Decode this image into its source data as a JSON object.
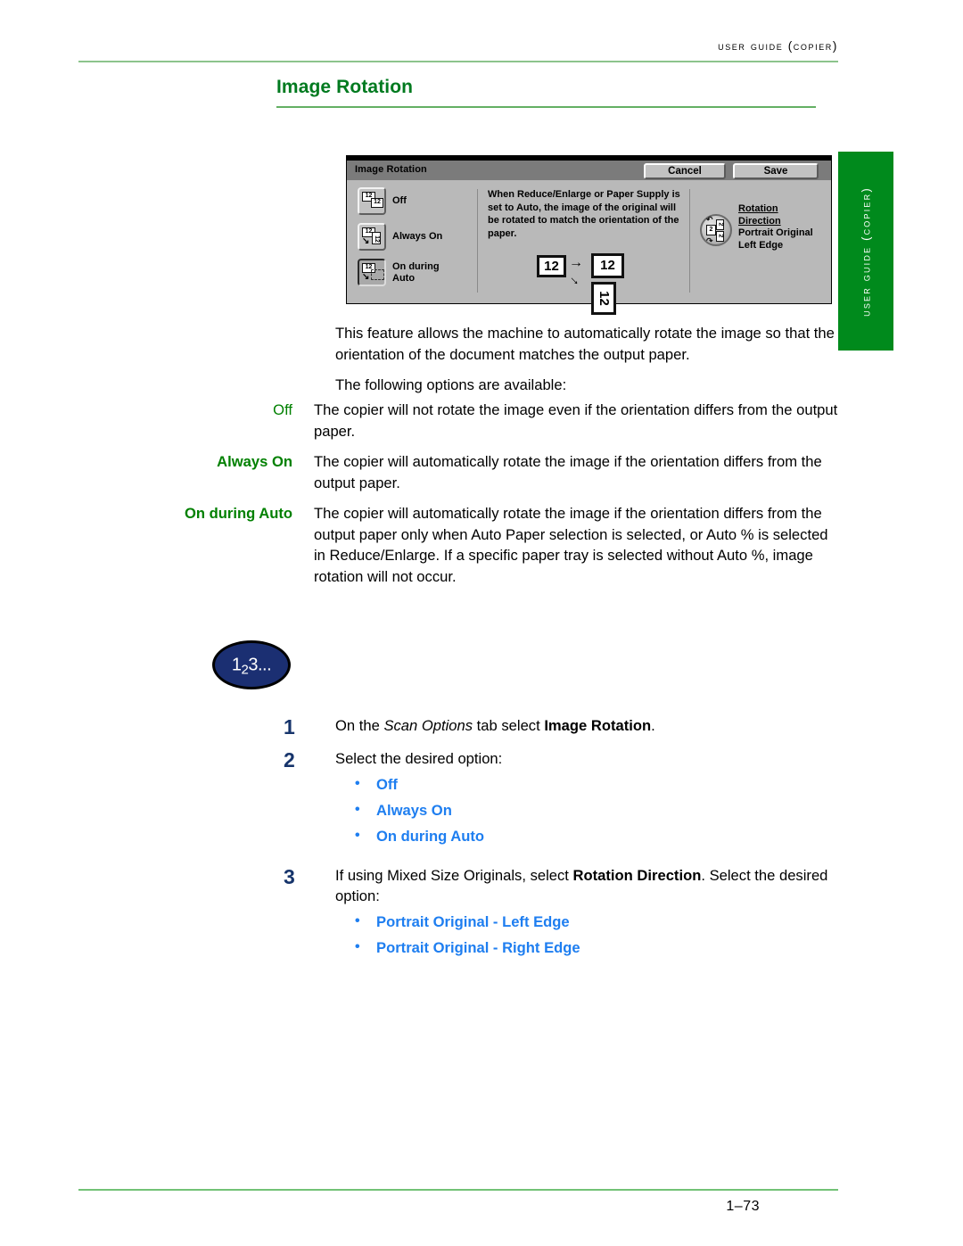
{
  "header": {
    "running_head": "User Guide (Copier)",
    "rule_color": "#8cc48c"
  },
  "title": {
    "text": "Image Rotation",
    "color": "#007a1f"
  },
  "side_tab": {
    "text": "User Guide (Copier)",
    "background": "#008a1c",
    "text_color": "#ffffff"
  },
  "ui_screenshot": {
    "titlebar": {
      "label": "Image Rotation",
      "cancel_label": "Cancel",
      "save_label": "Save"
    },
    "options": [
      {
        "label": "Off",
        "selected": false
      },
      {
        "label": "Always On",
        "selected": false
      },
      {
        "label": "On during\nAuto",
        "selected": true
      }
    ],
    "description": "When Reduce/Enlarge or Paper Supply is set to Auto, the image of the original will be rotated to match the orientation of the paper.",
    "diagram": {
      "source": "12",
      "dest_upright": "12",
      "dest_rotated": "12"
    },
    "rotation_direction": {
      "line1": "Rotation",
      "line2": "Direction",
      "line3": "Portrait Original",
      "line4": "Left Edge",
      "icon_digit": "2"
    }
  },
  "prose": {
    "para1": "This feature allows the machine to automatically rotate the image so that the orientation of the document matches the output paper.",
    "para2": "The following options are available:"
  },
  "definitions": [
    {
      "term": "Off",
      "description": "The copier will not rotate the image even if the orientation differs from the output paper."
    },
    {
      "term": "Always On",
      "description": "The copier will automatically rotate the image if the orientation differs from the output paper."
    },
    {
      "term": "On during Auto",
      "description": "The copier will automatically rotate the image if the orientation differs from the output paper only when Auto Paper selection is selected, or Auto % is selected in Reduce/Enlarge.  If a specific paper tray is selected without Auto %, image rotation will not occur."
    }
  ],
  "badge": {
    "main": "1",
    "sub": "2",
    "tail": "3..."
  },
  "steps": [
    {
      "number": "1",
      "text_before": "On the ",
      "italic": "Scan Options",
      "text_middle": " tab select ",
      "bold": "Image Rotation",
      "text_after": ".",
      "bullets": []
    },
    {
      "number": "2",
      "text_before": "Select the desired option:",
      "italic": "",
      "text_middle": "",
      "bold": "",
      "text_after": "",
      "bullets": [
        "Off",
        "Always On",
        "On during Auto"
      ]
    },
    {
      "number": "3",
      "text_before": "If using Mixed Size Originals, select ",
      "italic": "",
      "text_middle": "",
      "bold": "Rotation Direction",
      "text_after": ". Select the desired option:",
      "bullets": [
        "Portrait Original - Left Edge",
        "Portrait Original - Right Edge"
      ]
    }
  ],
  "footer": {
    "page_number": "1–73"
  },
  "colors": {
    "green_heading": "#007a1f",
    "green_term": "#008000",
    "blue_bullet": "#1e7ef0",
    "navy_step": "#16346b",
    "tab_green": "#008a1c"
  }
}
